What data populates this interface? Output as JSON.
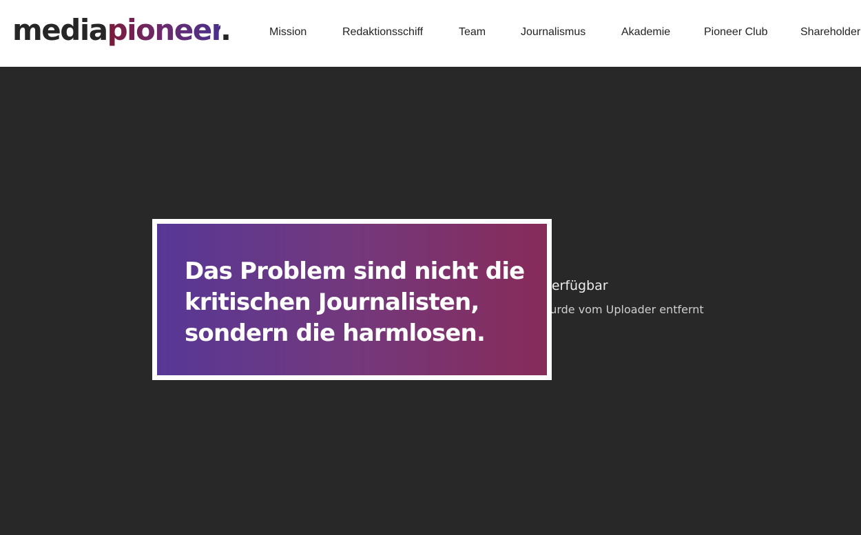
{
  "header": {
    "logo": {
      "part1": "media",
      "part2": "pioneer",
      "dot": "."
    },
    "nav": [
      {
        "label": "Mission"
      },
      {
        "label": "Redaktionsschiff"
      },
      {
        "label": "Team"
      },
      {
        "label": "Journalismus"
      },
      {
        "label": "Akademie"
      },
      {
        "label": "Pioneer Club"
      },
      {
        "label": "Shareholder"
      }
    ]
  },
  "video": {
    "icon": "alert-circle-icon",
    "title": "Video nicht verfügbar",
    "subtitle": "Dieses Video wurde vom Uploader entfernt"
  },
  "quote": {
    "text": "Das Problem sind nicht die kritischen Journalisten, sondern die harmlosen."
  },
  "colors": {
    "header_bg": "#ffffff",
    "video_bg": "#282828",
    "gradient_start": "#4a288e",
    "gradient_end": "#7d194b",
    "logo_dark": "#262626"
  }
}
